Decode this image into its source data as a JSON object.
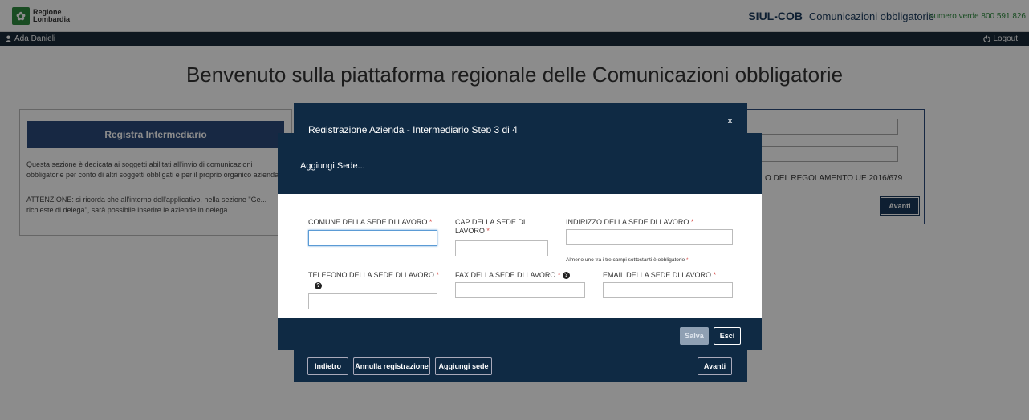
{
  "header": {
    "logo_line1": "Regione",
    "logo_line2": "Lombardia",
    "app_name": "SIUL-COB",
    "app_subtitle": "Comunicazioni obbligatorie",
    "hotline": "Numero verde 800 591 826"
  },
  "userbar": {
    "user_name": "Ada Danieli",
    "logout_label": "Logout"
  },
  "page": {
    "welcome": "Benvenuto sulla piattaforma regionale delle Comunicazioni obbligatorie",
    "left_card": {
      "title": "Registra Intermediario",
      "text1": "Questa sezione è dedicata ai soggetti abilitati all'invio di comunicazioni obbligatorie per conto di altri soggetti obbligati e per il proprio organico aziendale.",
      "text2": "ATTENZIONE: si ricorda che all'interno dell'applicativo, nella sezione \"Ge... richieste di delega\", sarà possibile inserire le aziende in delega."
    },
    "right_card": {
      "text": "O DEL REGOLAMENTO UE 2016/679",
      "button": "Avanti"
    }
  },
  "step_modal": {
    "title": "Registrazione Azienda - Intermediario   Step 3 di 4",
    "close": "×",
    "buttons": {
      "back": "Indietro",
      "cancel": "Annulla registrazione",
      "add": "Aggiungi sede",
      "next": "Avanti"
    }
  },
  "inner_modal": {
    "title": "Aggiungi Sede...",
    "fields": {
      "comune": "COMUNE DELLA SEDE DI LAVORO",
      "cap": "CAP DELLA SEDE DI LAVORO",
      "indirizzo": "INDIRIZZO DELLA SEDE DI LAVORO",
      "telefono": "TELEFONO DELLA SEDE DI LAVORO",
      "fax": "FAX DELLA SEDE DI LAVORO",
      "email": "EMAIL DELLA SEDE DI LAVORO"
    },
    "required_mark": "*",
    "note": "Almeno uno tra i tre campi sottostanti è obbligatorio",
    "buttons": {
      "save": "Salva",
      "exit": "Esci"
    }
  }
}
